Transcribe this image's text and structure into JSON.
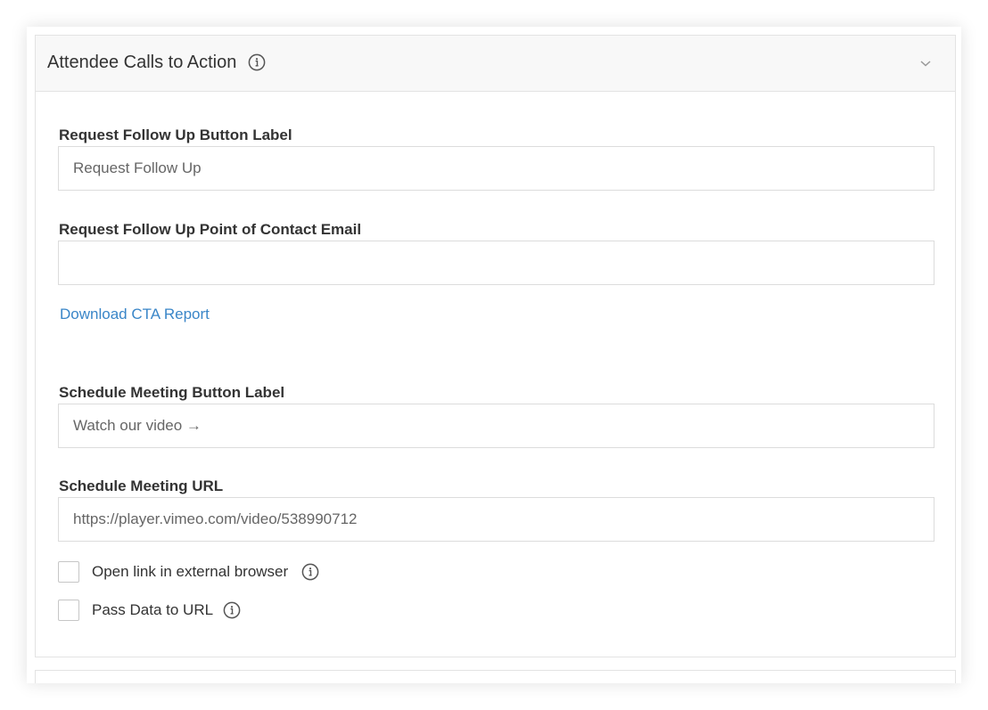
{
  "section": {
    "title": "Attendee Calls to Action",
    "info_icon": "info-icon",
    "toggle_icon": "chevron-down-icon"
  },
  "fields": {
    "follow_up_label": {
      "label": "Request Follow Up Button Label",
      "value": "Request Follow Up"
    },
    "follow_up_email": {
      "label": "Request Follow Up Point of Contact Email",
      "value": ""
    },
    "download_link": "Download CTA Report",
    "schedule_label": {
      "label": "Schedule Meeting Button Label",
      "value": "Watch our video →"
    },
    "schedule_url": {
      "label": "Schedule Meeting URL",
      "value": "https://player.vimeo.com/video/538990712"
    }
  },
  "options": {
    "external_browser": {
      "label": "Open link in external browser",
      "checked": false
    },
    "pass_data": {
      "label": "Pass Data to URL",
      "checked": false
    }
  },
  "colors": {
    "link": "#3a86c8",
    "border": "#dcdcdc",
    "header_bg": "#f8f8f8"
  }
}
